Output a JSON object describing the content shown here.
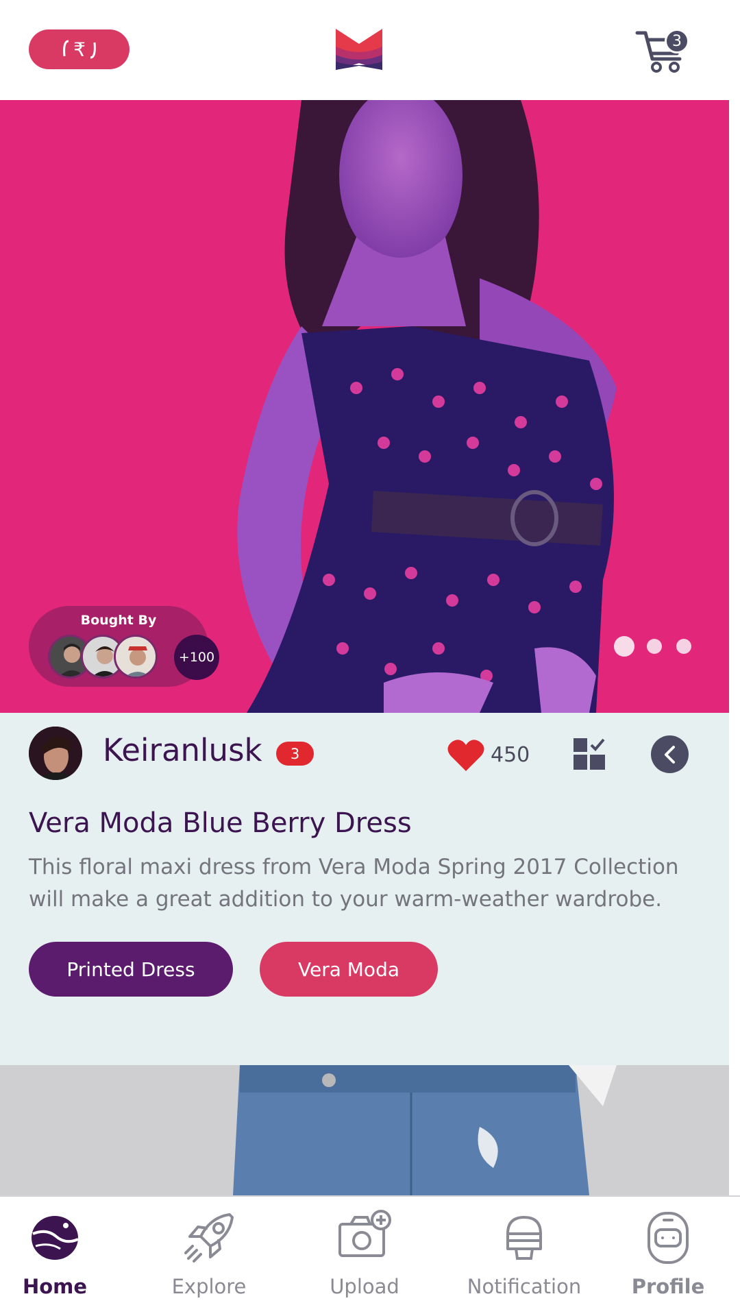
{
  "header": {
    "currency_icon": "rupee-exchange-icon",
    "logo_icon": "brand-logo-icon",
    "cart_icon": "cart-icon",
    "cart_count": "3"
  },
  "hero": {
    "image": "model-in-floral-dress",
    "bought_by_label": "Bought By",
    "buyers": [
      "buyer-avatar-1",
      "buyer-avatar-2",
      "buyer-avatar-3"
    ],
    "more_buyers": "+100",
    "carousel_dots": 3,
    "active_dot": 0
  },
  "post": {
    "username": "Keiranlusk",
    "user_badge": "3",
    "likes": "450",
    "title": "Vera Moda Blue Berry Dress",
    "description": "This floral maxi dress from Vera Moda Spring 2017 Collection will make a great addition to your warm-weather wardrobe.",
    "tags": [
      "Printed Dress",
      "Vera Moda"
    ]
  },
  "nav": {
    "items": [
      {
        "label": "Home",
        "icon": "planet-icon",
        "active": true
      },
      {
        "label": "Explore",
        "icon": "rocket-icon",
        "active": false
      },
      {
        "label": "Upload",
        "icon": "camera-add-icon",
        "active": false
      },
      {
        "label": "Notification",
        "icon": "bell-icon",
        "active": false
      },
      {
        "label": "Profile",
        "icon": "astronaut-icon",
        "active": false
      }
    ]
  },
  "colors": {
    "brand_pink": "#d93a64",
    "brand_purple": "#5c1c6e",
    "hero_bg": "#e2277a",
    "detail_bg": "#e6f0f1"
  }
}
